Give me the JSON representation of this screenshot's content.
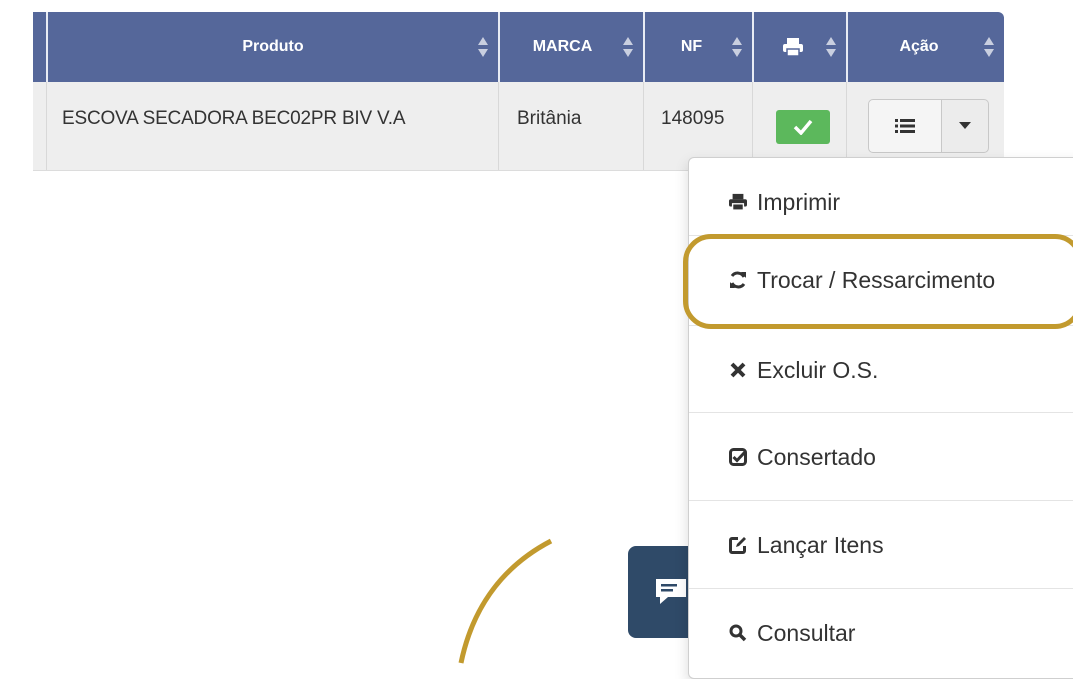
{
  "table": {
    "headers": {
      "produto": "Produto",
      "marca": "MARCA",
      "nf": "NF",
      "acao": "Ação"
    },
    "rows": [
      {
        "produto": "ESCOVA SECADORA BEC02PR BIV V.A",
        "marca": "Britânia",
        "nf": "148095",
        "printed": true
      }
    ]
  },
  "menu": {
    "items": [
      {
        "label": "Imprimir",
        "icon": "print-icon"
      },
      {
        "label": "Trocar / Ressarcimento",
        "icon": "refresh-icon"
      },
      {
        "label": "Excluir O.S.",
        "icon": "times-icon"
      },
      {
        "label": "Consertado",
        "icon": "check-square-icon"
      },
      {
        "label": "Lançar Itens",
        "icon": "edit-icon"
      },
      {
        "label": "Consultar",
        "icon": "search-icon"
      }
    ]
  },
  "colors": {
    "header_bg": "#55679a",
    "success": "#5cb85c",
    "highlight": "#c29a2e",
    "chat_bg": "#2f4a68"
  }
}
